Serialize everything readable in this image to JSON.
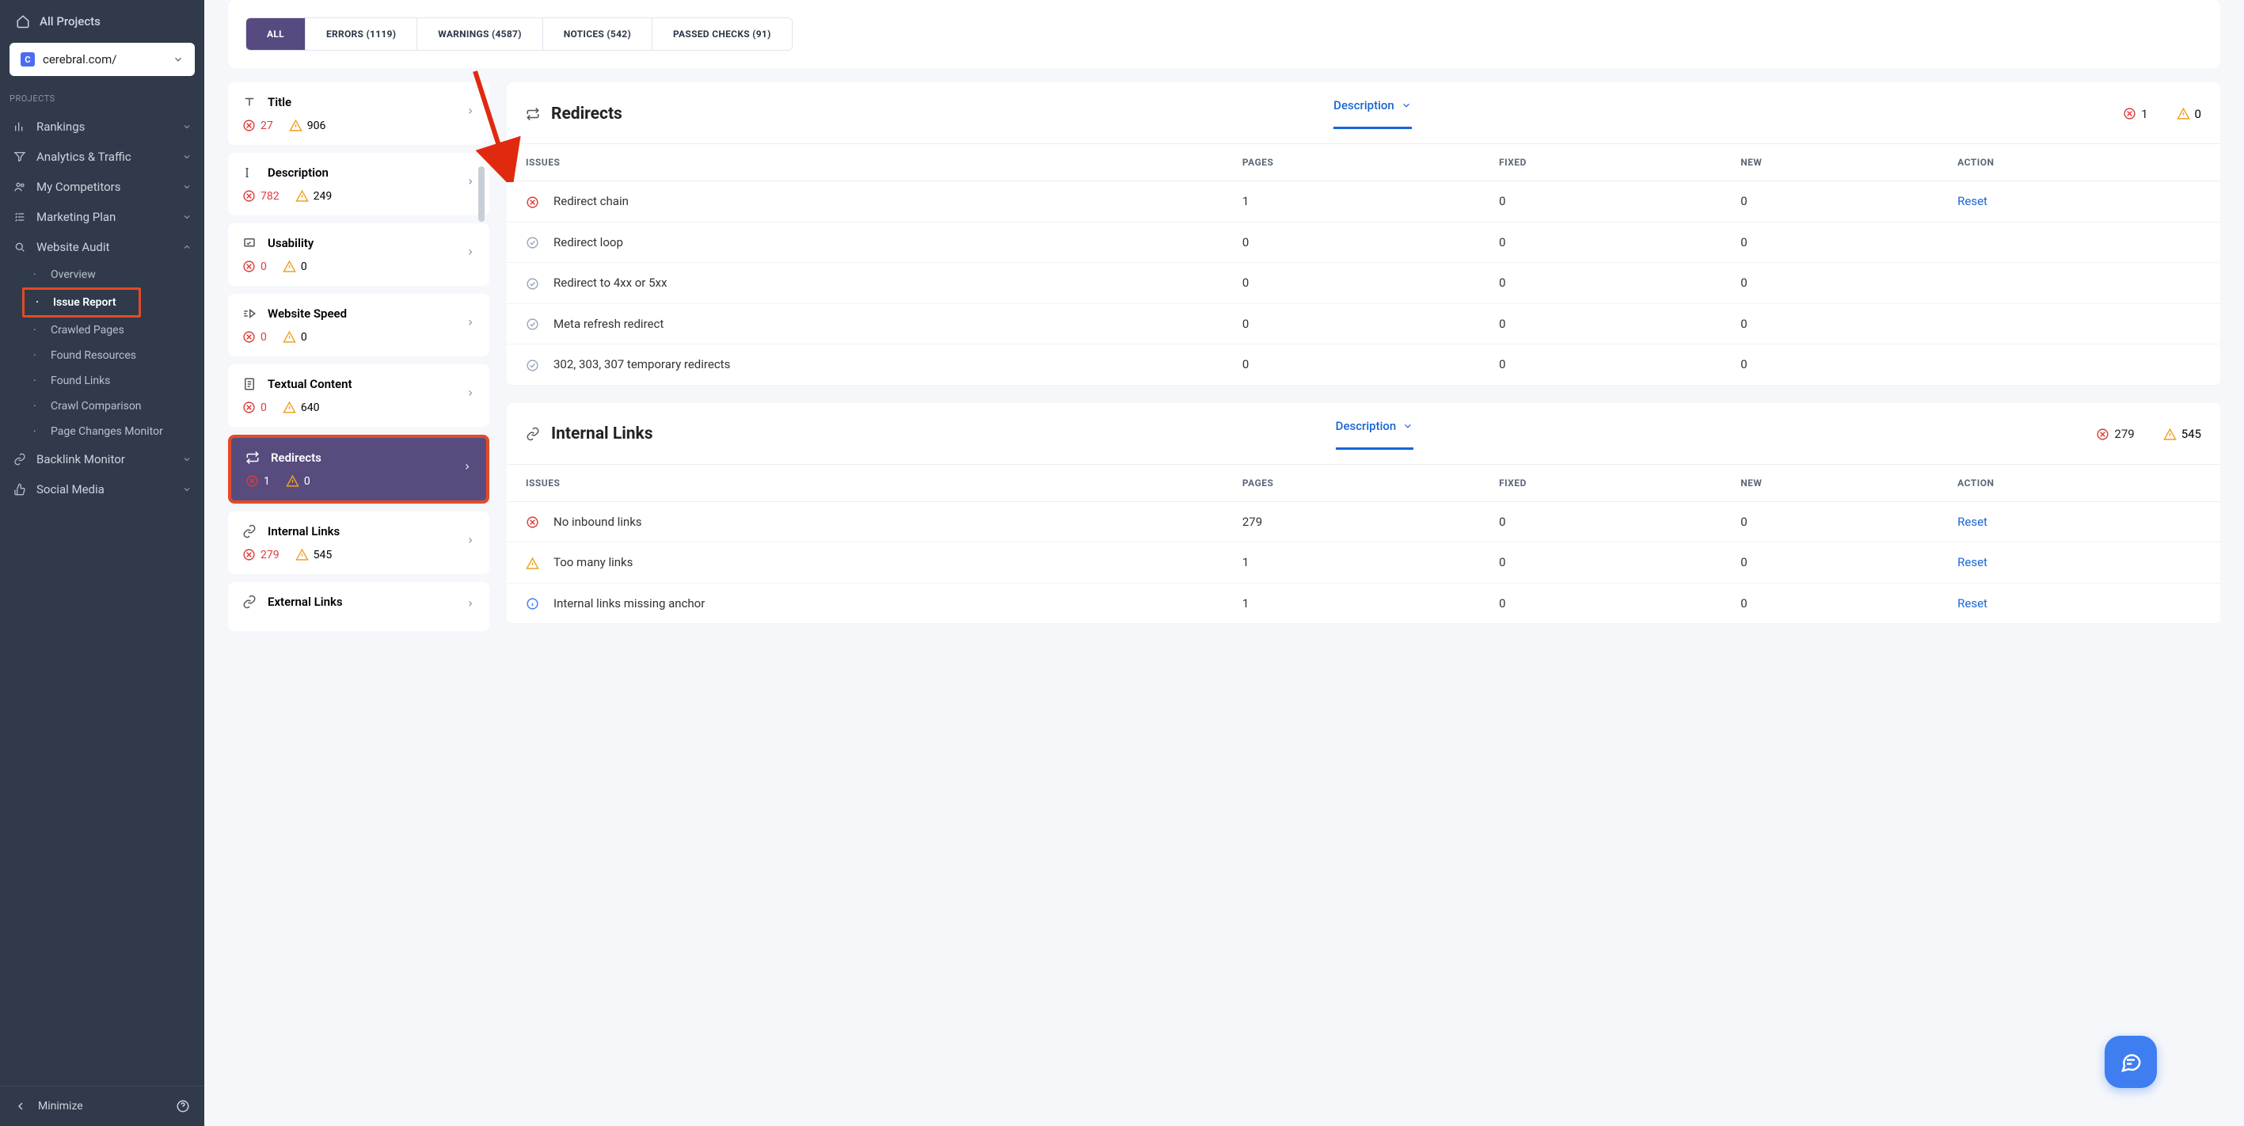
{
  "sidebar": {
    "all_projects": "All Projects",
    "project_name": "cerebral.com/",
    "projects_label": "PROJECTS",
    "nav": {
      "rankings": "Rankings",
      "analytics": "Analytics & Traffic",
      "competitors": "My Competitors",
      "marketing": "Marketing Plan",
      "audit": "Website Audit",
      "backlink": "Backlink Monitor",
      "social": "Social Media"
    },
    "subnav": {
      "overview": "Overview",
      "issue_report": "Issue Report",
      "crawled": "Crawled Pages",
      "resources": "Found Resources",
      "links": "Found Links",
      "crawl_compare": "Crawl Comparison",
      "page_changes": "Page Changes Monitor"
    },
    "minimize": "Minimize"
  },
  "tabs": {
    "all": "ALL",
    "errors": "ERRORS (1119)",
    "warnings": "WARNINGS (4587)",
    "notices": "NOTICES (542)",
    "passed": "PASSED CHECKS (91)"
  },
  "issue_cards": [
    {
      "key": "title",
      "label": "Title",
      "err": "27",
      "warn": "906"
    },
    {
      "key": "description",
      "label": "Description",
      "err": "782",
      "warn": "249"
    },
    {
      "key": "usability",
      "label": "Usability",
      "err": "0",
      "warn": "0"
    },
    {
      "key": "speed",
      "label": "Website Speed",
      "err": "0",
      "warn": "0"
    },
    {
      "key": "textual",
      "label": "Textual Content",
      "err": "0",
      "warn": "640"
    },
    {
      "key": "redirects",
      "label": "Redirects",
      "err": "1",
      "warn": "0"
    },
    {
      "key": "internal",
      "label": "Internal Links",
      "err": "279",
      "warn": "545"
    },
    {
      "key": "external",
      "label": "External Links"
    }
  ],
  "sections": [
    {
      "id": "redirects",
      "title": "Redirects",
      "desc_label": "Description",
      "total_err": "1",
      "total_warn": "0",
      "columns": [
        "ISSUES",
        "PAGES",
        "FIXED",
        "NEW",
        "ACTION"
      ],
      "rows": [
        {
          "icon": "err",
          "name": "Redirect chain",
          "pages": "1",
          "fixed": "0",
          "new": "0",
          "action": "Reset"
        },
        {
          "icon": "ok",
          "name": "Redirect loop",
          "pages": "0",
          "fixed": "0",
          "new": "0",
          "action": ""
        },
        {
          "icon": "ok",
          "name": "Redirect to 4xx or 5xx",
          "pages": "0",
          "fixed": "0",
          "new": "0",
          "action": ""
        },
        {
          "icon": "ok",
          "name": "Meta refresh redirect",
          "pages": "0",
          "fixed": "0",
          "new": "0",
          "action": ""
        },
        {
          "icon": "ok",
          "name": "302, 303, 307 temporary redirects",
          "pages": "0",
          "fixed": "0",
          "new": "0",
          "action": ""
        }
      ]
    },
    {
      "id": "internal",
      "title": "Internal Links",
      "desc_label": "Description",
      "total_err": "279",
      "total_warn": "545",
      "columns": [
        "ISSUES",
        "PAGES",
        "FIXED",
        "NEW",
        "ACTION"
      ],
      "rows": [
        {
          "icon": "err",
          "name": "No inbound links",
          "pages": "279",
          "fixed": "0",
          "new": "0",
          "action": "Reset"
        },
        {
          "icon": "warn",
          "name": "Too many links",
          "pages": "1",
          "fixed": "0",
          "new": "0",
          "action": "Reset"
        },
        {
          "icon": "info",
          "name": "Internal links missing anchor",
          "pages": "1",
          "fixed": "0",
          "new": "0",
          "action": "Reset"
        }
      ]
    }
  ]
}
